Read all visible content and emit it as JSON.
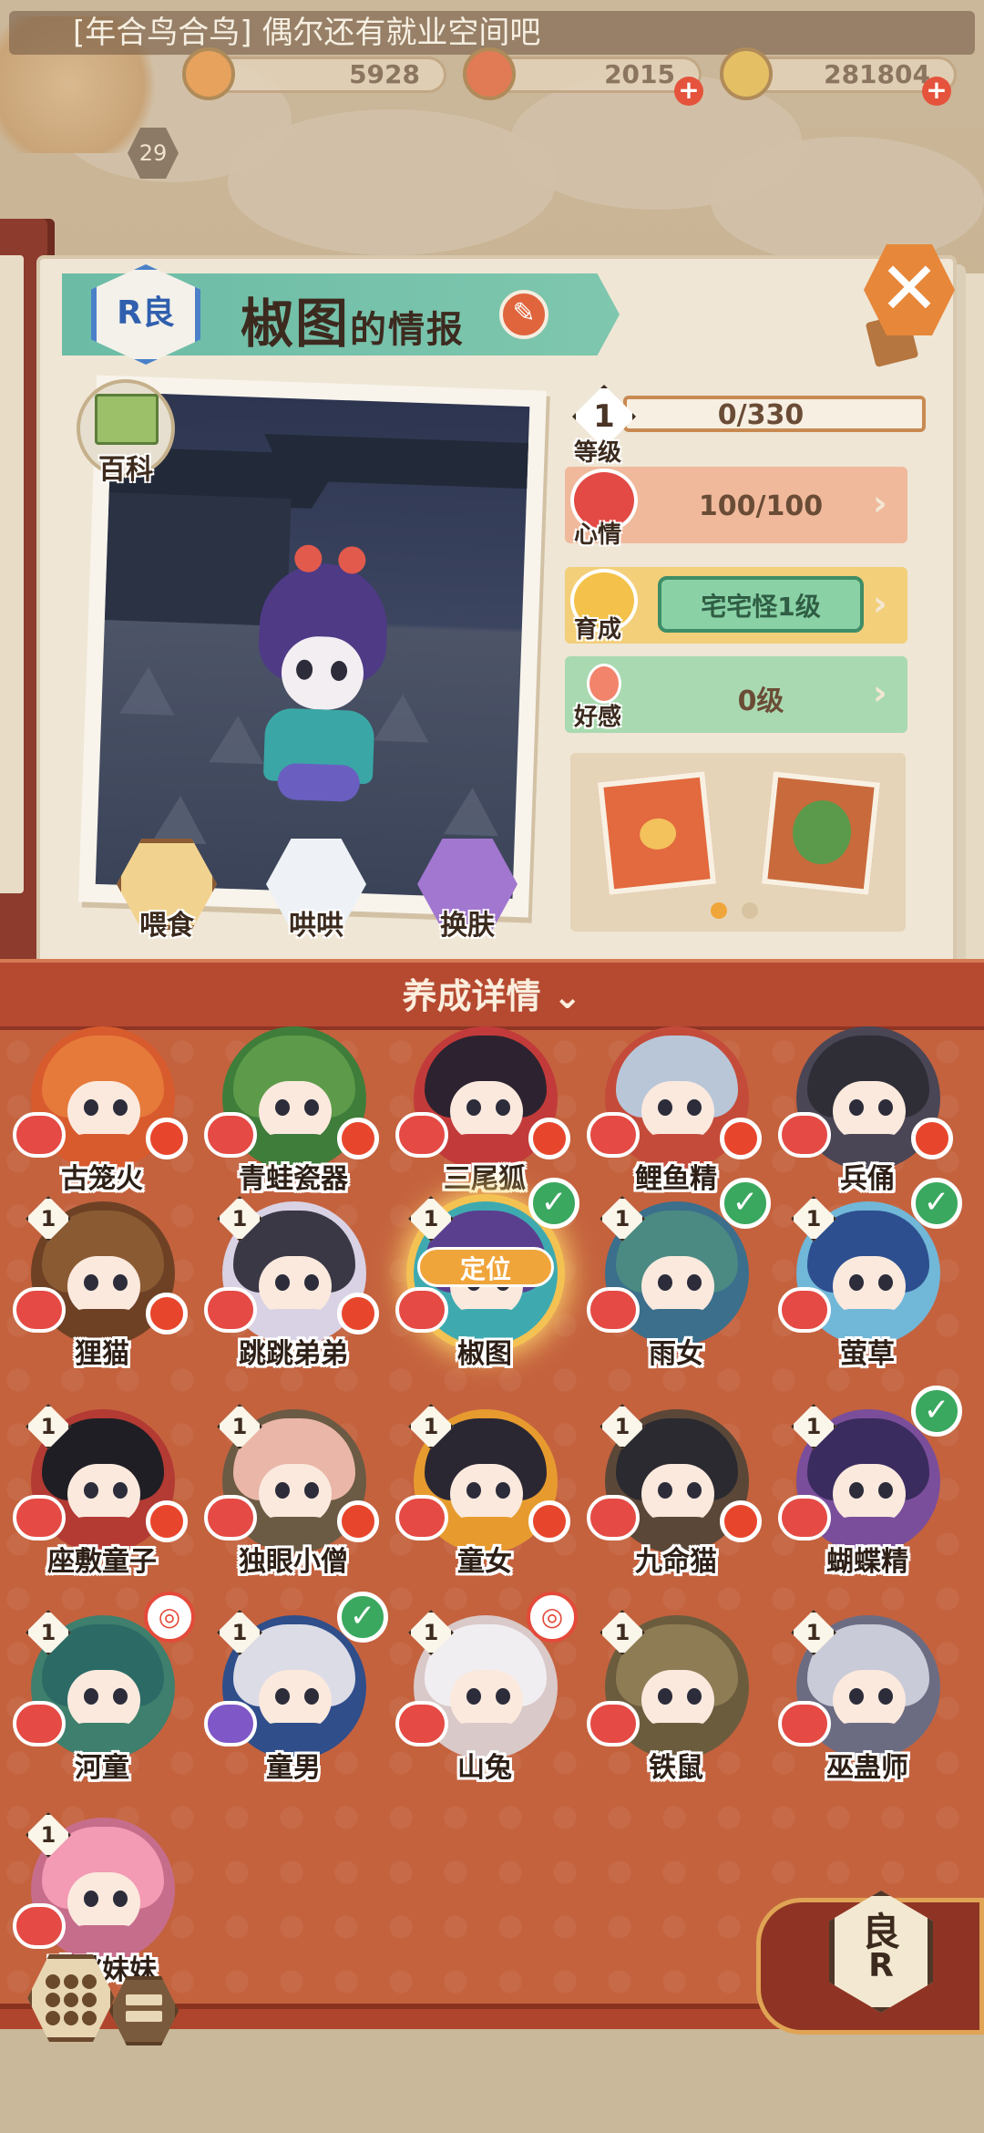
{
  "header": {
    "channel_message": "[年合鸟合鸟] 偶尔还有就业空间吧",
    "player_level": "29",
    "resources": [
      {
        "name": "stamina",
        "value": "5928",
        "icon": "jade-icon"
      },
      {
        "name": "tickets",
        "value": "2015",
        "icon": "scroll-icon"
      },
      {
        "name": "coins",
        "value": "281804",
        "icon": "coin-icon"
      }
    ],
    "add_symbol": "+"
  },
  "info": {
    "rarity_badge": "R良",
    "character_name": "椒图",
    "title_suffix": "的情报",
    "encyclopedia_label": "百科",
    "close_symbol": "✕",
    "edit_symbol": "✎",
    "actions": [
      {
        "id": "feed",
        "label": "喂食"
      },
      {
        "id": "coax",
        "label": "哄哄"
      },
      {
        "id": "skin",
        "label": "换肤"
      }
    ],
    "stats": {
      "level": {
        "label": "等级",
        "badge": "1",
        "value": "0/330"
      },
      "mood": {
        "label": "心情",
        "value": "100/100"
      },
      "growth": {
        "label": "育成",
        "value": "宅宅怪1级"
      },
      "affection": {
        "label": "好感",
        "value": "0级"
      }
    },
    "chevron": "›",
    "gallery_pages": 2,
    "gallery_active_page": 1
  },
  "roster": {
    "section_title": "养成详情",
    "section_toggle": "⌄",
    "locate_label": "定位",
    "tiles": [
      {
        "name": "古笼火",
        "level": "",
        "badge": "dot",
        "hair": "#e67a3a",
        "body": "#d85b2e",
        "selected": false,
        "heart": "red"
      },
      {
        "name": "青蛙瓷器",
        "level": "",
        "badge": "dot",
        "hair": "#5d9b4a",
        "body": "#3f7d3a",
        "selected": false,
        "heart": "red"
      },
      {
        "name": "三尾狐",
        "level": "",
        "badge": "dot",
        "hair": "#2d2330",
        "body": "#c23b3a",
        "selected": false,
        "heart": "red"
      },
      {
        "name": "鲤鱼精",
        "level": "",
        "badge": "dot",
        "hair": "#b8c6d8",
        "body": "#c44b3a",
        "selected": false,
        "heart": "red"
      },
      {
        "name": "兵俑",
        "level": "",
        "badge": "dot",
        "hair": "#2f2e36",
        "body": "#4a4656",
        "selected": false,
        "heart": "red"
      },
      {
        "name": "狸猫",
        "level": "1",
        "badge": "dot",
        "hair": "#8a5a33",
        "body": "#6e4125",
        "selected": false,
        "heart": "red"
      },
      {
        "name": "跳跳弟弟",
        "level": "1",
        "badge": "dot",
        "hair": "#3a3845",
        "body": "#d9d2e4",
        "selected": false,
        "heart": "red"
      },
      {
        "name": "椒图",
        "level": "1",
        "badge": "check",
        "hair": "#5a3f8f",
        "body": "#3eaab0",
        "selected": true,
        "heart": "red"
      },
      {
        "name": "雨女",
        "level": "1",
        "badge": "check",
        "hair": "#4a8a82",
        "body": "#3b6f8c",
        "selected": false,
        "heart": "red"
      },
      {
        "name": "萤草",
        "level": "1",
        "badge": "check",
        "hair": "#2d4f8f",
        "body": "#71b7d8",
        "selected": false,
        "heart": "red"
      },
      {
        "name": "座敷童子",
        "level": "1",
        "badge": "dot",
        "hair": "#1f1e24",
        "body": "#b43a34",
        "selected": false,
        "heart": "red"
      },
      {
        "name": "独眼小僧",
        "level": "1",
        "badge": "dot",
        "hair": "#e9b6a7",
        "body": "#6b5a44",
        "selected": false,
        "heart": "red"
      },
      {
        "name": "童女",
        "level": "1",
        "badge": "dot",
        "hair": "#2a2733",
        "body": "#e79b2f",
        "selected": false,
        "heart": "red"
      },
      {
        "name": "九命猫",
        "level": "1",
        "badge": "dot",
        "hair": "#2b2a30",
        "body": "#5b4738",
        "selected": false,
        "heart": "red"
      },
      {
        "name": "蝴蝶精",
        "level": "1",
        "badge": "check",
        "hair": "#3a2c5e",
        "body": "#7a4e9b",
        "selected": false,
        "heart": "red"
      },
      {
        "name": "河童",
        "level": "1",
        "badge": "medal",
        "hair": "#2c6a66",
        "body": "#3e7f6d",
        "selected": false,
        "heart": "red"
      },
      {
        "name": "童男",
        "level": "1",
        "badge": "check",
        "hair": "#dcdce6",
        "body": "#2f4e8a",
        "selected": false,
        "heart": "purple"
      },
      {
        "name": "山兔",
        "level": "1",
        "badge": "medal",
        "hair": "#f1eef2",
        "body": "#d9c9c9",
        "selected": false,
        "heart": "red"
      },
      {
        "name": "铁鼠",
        "level": "1",
        "badge": "none",
        "hair": "#8e7c55",
        "body": "#6c5c3e",
        "selected": false,
        "heart": "red"
      },
      {
        "name": "巫蛊师",
        "level": "1",
        "badge": "none",
        "hair": "#c9cbd8",
        "body": "#6b6c82",
        "selected": false,
        "heart": "red"
      },
      {
        "name": "跳跳妹妹",
        "level": "1",
        "badge": "none",
        "hair": "#f39ab4",
        "body": "#c76d8c",
        "selected": false,
        "heart": "red"
      }
    ]
  },
  "filter": {
    "top": "良",
    "bottom": "R"
  },
  "colors": {
    "accent": "#c4623e",
    "banner": "#7fc7ae",
    "mood_row": "#f0b99c",
    "growth_row": "#f3cf7a",
    "affection_row": "#a9d9b0"
  }
}
